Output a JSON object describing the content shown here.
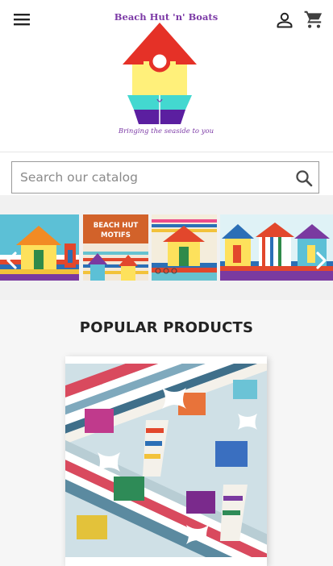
{
  "header": {
    "menu_icon": "menu-icon",
    "user_icon": "user-icon",
    "cart_icon": "cart-icon",
    "logo": {
      "title": "Beach Hut 'n' Boats",
      "tagline": "Bringing the seaside to you"
    }
  },
  "search": {
    "placeholder": "Search our catalog",
    "icon": "search-icon"
  },
  "carousel": {
    "tile_text": "BEACH HUT MOTIFS",
    "prev_icon": "chevron-left-icon",
    "next_icon": "chevron-right-icon"
  },
  "popular": {
    "title": "POPULAR PRODUCTS"
  },
  "colors": {
    "brand_purple": "#7c3aa6",
    "text": "#232323",
    "motifs_orange": "#d2622a"
  }
}
